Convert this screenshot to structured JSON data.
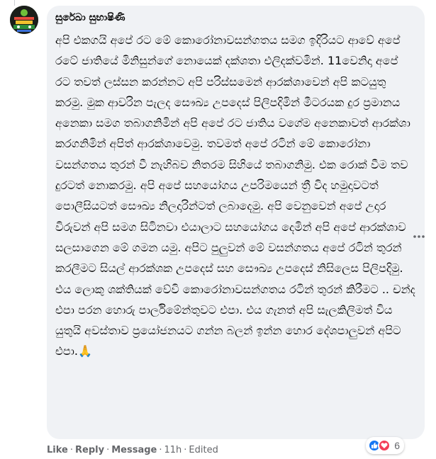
{
  "comment": {
    "author": "සුරේඛා සුභාෂිණි",
    "text": "අපි එකගයි අපේ රට මේ කොරෝනාවසන්ගතය සමග ඉදිරියට ආවේ අපේ රටේ ජාතියේ මිනිසුන්ගේ නොයෙක් දක්ශතා එලිදක්වමින්. 11වෙනිදා අපේ රට තවත් ලස්සන කරන්නට අපි පරිස්සමෙන් ආරක්ශාවෙන් අපි කටයුතු කරමු. මුක ආවරින පැලද සෞඛ්‍ය උපදෙස් පිලිපදිමින් මීටරයක දුර ප්‍රමානය අනෙකා සමග තබාගනිමින් අපි අපේ රට ජාතිය වගේම අනෙකාවත් ආරක්ශා කරගනිමින් අපිත් ආරක්ශාවෙමු. තවමත් අපේ රටින් මේ කොරෝනා වසන්ගතය තුරන් වී නැහිබව නිතරම සිහියේ තබාගනිමු. එක රොක් වීම තව දුරටත් නොකරමු. අපි අපේ සහයෝගය උපරිමයෙන් ත්‍රී විද හමුදාවටත් පොලීසියටත් සෞඛ්‍ය නිලදාරින්ටත් ලබාදෙමු. අපි වෙනුවෙන් අපේ උදාර විරුවන් අපි සමග සිටිනවා එයාලාට සහයෝගය දෙමින් අපි අපේ ආරක්ශාව සලසාගෙන මේ ගමන යමු. අපිට පුලුවන් මේ වසන්ගතය අපේ රටින් තුරන් කරලීමට සියල් ආරක්ශක උපදෙස් සහ සෞඛ්‍ය උපදෙස් නිසිලෙස පිලිපදිමු. එය ලොකු ශක්තියක් වේවි කොරෝනාවසන්ගතය රටින් තුරන් කිරීමට .. චන්ද එපා පරන හොරු පාර්ලිමේන්තුවට එපා. එය ගැනත් අපි සැලකිලිමත් විය යුතුයි අවස්තාව ප්‍රයෝජනයට ගන්න බලන් ඉන්න හොර දේශපාලුවන් අපිට එපා.",
    "emoji": "🙏"
  },
  "actions": {
    "like": "Like",
    "reply": "Reply",
    "message": "Message",
    "time": "11h",
    "edited": "Edited"
  },
  "reactions": {
    "types": [
      "like-icon",
      "love-icon"
    ],
    "count": "6",
    "colors": {
      "like": "#1877f2",
      "love": "#f33e58"
    }
  },
  "icons": {
    "more": "more-options-icon"
  }
}
